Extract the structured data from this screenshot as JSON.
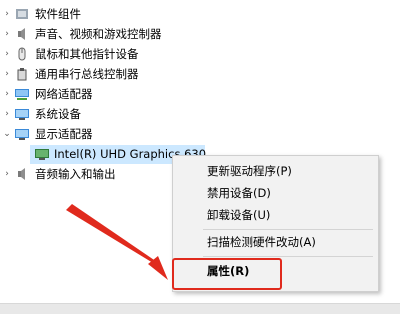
{
  "tree": {
    "items": [
      {
        "label": "软件组件",
        "icon": "software-component-icon",
        "expanded": false
      },
      {
        "label": "声音、视频和游戏控制器",
        "icon": "speaker-icon",
        "expanded": false
      },
      {
        "label": "鼠标和其他指针设备",
        "icon": "mouse-icon",
        "expanded": false
      },
      {
        "label": "通用串行总线控制器",
        "icon": "usb-icon",
        "expanded": false
      },
      {
        "label": "网络适配器",
        "icon": "network-adapter-icon",
        "expanded": false
      },
      {
        "label": "系统设备",
        "icon": "system-device-icon",
        "expanded": false
      },
      {
        "label": "显示适配器",
        "icon": "display-adapter-icon",
        "expanded": true
      },
      {
        "label": "音频输入和输出",
        "icon": "audio-io-icon",
        "expanded": false
      }
    ],
    "child": {
      "label": "Intel(R) UHD Graphics 630",
      "icon": "display-adapter-icon",
      "selected": true
    }
  },
  "context_menu": {
    "items": [
      {
        "label": "更新驱动程序(P)"
      },
      {
        "label": "禁用设备(D)"
      },
      {
        "label": "卸载设备(U)"
      },
      {
        "label": "扫描检测硬件改动(A)"
      },
      {
        "label": "属性(R)",
        "bold": true
      }
    ]
  },
  "colors": {
    "selection": "#cce8ff",
    "annotation": "#e02a1d"
  }
}
